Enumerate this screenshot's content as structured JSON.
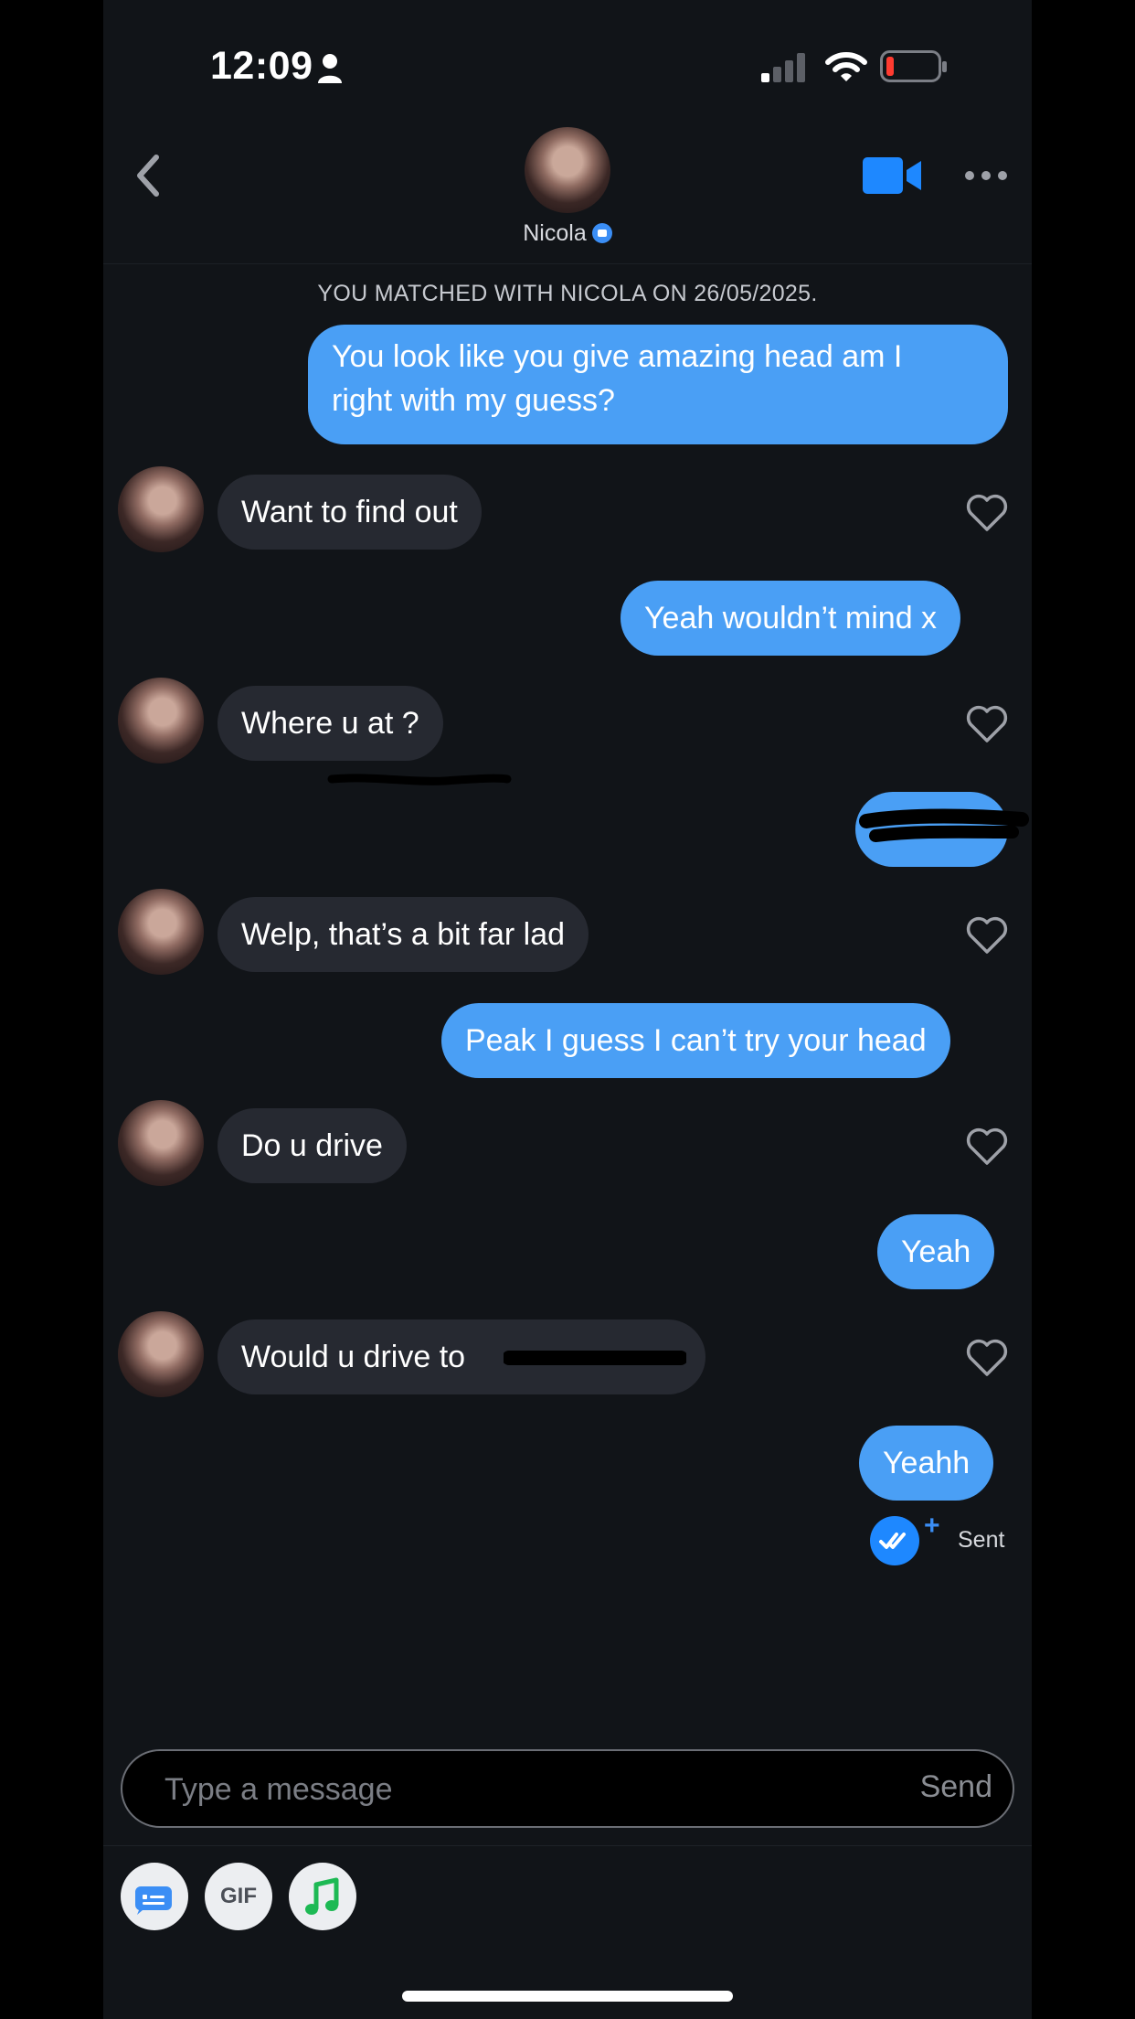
{
  "status_bar": {
    "time": "12:09"
  },
  "header": {
    "name": "Nicola"
  },
  "match_banner": "YOU MATCHED WITH NICOLA ON 26/05/2025.",
  "messages": [
    {
      "from": "me",
      "lines": [
        "You look like you give amazing head am I",
        "right with my guess?"
      ]
    },
    {
      "from": "them",
      "text": "Want to find out"
    },
    {
      "from": "me",
      "text": "Yeah wouldn’t mind x"
    },
    {
      "from": "them",
      "text": "Where u at ?"
    },
    {
      "from": "me",
      "text": ""
    },
    {
      "from": "them",
      "text": "Welp, that’s a bit far lad"
    },
    {
      "from": "me",
      "text": "Peak I guess I can’t try your head"
    },
    {
      "from": "them",
      "text": "Do u drive"
    },
    {
      "from": "me",
      "text": "Yeah"
    },
    {
      "from": "them",
      "text": "Would u drive to"
    },
    {
      "from": "me",
      "text": "Yeahh"
    }
  ],
  "sent_status": "Sent",
  "composer": {
    "placeholder": "Type a message",
    "send_label": "Send"
  },
  "tools": {
    "gif_label": "GIF"
  },
  "colors": {
    "sent_bubble": "#4a9ff5",
    "received_bubble": "#262931",
    "background": "#111418",
    "accent": "#3b8ef5"
  }
}
